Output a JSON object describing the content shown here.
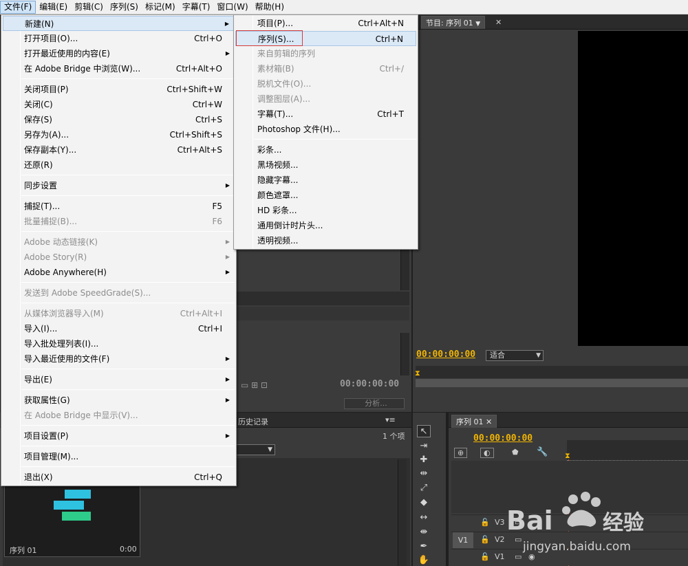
{
  "menubar": [
    "文件(F)",
    "编辑(E)",
    "剪辑(C)",
    "序列(S)",
    "标记(M)",
    "字幕(T)",
    "窗口(W)",
    "帮助(H)"
  ],
  "file_menu": [
    {
      "label": "新建(N)",
      "shortcut": "",
      "sub": true,
      "disabled": false,
      "highlight": true
    },
    {
      "label": "打开项目(O)...",
      "shortcut": "Ctrl+O",
      "sub": false,
      "disabled": false
    },
    {
      "label": "打开最近使用的内容(E)",
      "shortcut": "",
      "sub": true,
      "disabled": false
    },
    {
      "label": "在 Adobe Bridge 中浏览(W)...",
      "shortcut": "Ctrl+Alt+O",
      "sub": false,
      "disabled": false
    },
    {
      "sep": true
    },
    {
      "label": "关闭项目(P)",
      "shortcut": "Ctrl+Shift+W",
      "sub": false,
      "disabled": false
    },
    {
      "label": "关闭(C)",
      "shortcut": "Ctrl+W",
      "sub": false,
      "disabled": false
    },
    {
      "label": "保存(S)",
      "shortcut": "Ctrl+S",
      "sub": false,
      "disabled": false
    },
    {
      "label": "另存为(A)...",
      "shortcut": "Ctrl+Shift+S",
      "sub": false,
      "disabled": false
    },
    {
      "label": "保存副本(Y)...",
      "shortcut": "Ctrl+Alt+S",
      "sub": false,
      "disabled": false
    },
    {
      "label": "还原(R)",
      "shortcut": "",
      "sub": false,
      "disabled": false
    },
    {
      "sep": true
    },
    {
      "label": "同步设置",
      "shortcut": "",
      "sub": true,
      "disabled": false
    },
    {
      "sep": true
    },
    {
      "label": "捕捉(T)...",
      "shortcut": "F5",
      "sub": false,
      "disabled": false
    },
    {
      "label": "批量捕捉(B)...",
      "shortcut": "F6",
      "sub": false,
      "disabled": true
    },
    {
      "sep": true
    },
    {
      "label": "Adobe 动态链接(K)",
      "shortcut": "",
      "sub": true,
      "disabled": true
    },
    {
      "label": "Adobe Story(R)",
      "shortcut": "",
      "sub": true,
      "disabled": true
    },
    {
      "label": "Adobe Anywhere(H)",
      "shortcut": "",
      "sub": true,
      "disabled": false
    },
    {
      "sep": true
    },
    {
      "label": "发送到 Adobe SpeedGrade(S)...",
      "shortcut": "",
      "sub": false,
      "disabled": true
    },
    {
      "sep": true
    },
    {
      "label": "从媒体浏览器导入(M)",
      "shortcut": "Ctrl+Alt+I",
      "sub": false,
      "disabled": true
    },
    {
      "label": "导入(I)...",
      "shortcut": "Ctrl+I",
      "sub": false,
      "disabled": false
    },
    {
      "label": "导入批处理列表(I)...",
      "shortcut": "",
      "sub": false,
      "disabled": false
    },
    {
      "label": "导入最近使用的文件(F)",
      "shortcut": "",
      "sub": true,
      "disabled": false
    },
    {
      "sep": true
    },
    {
      "label": "导出(E)",
      "shortcut": "",
      "sub": true,
      "disabled": false
    },
    {
      "sep": true
    },
    {
      "label": "获取属性(G)",
      "shortcut": "",
      "sub": true,
      "disabled": false
    },
    {
      "label": "在 Adobe Bridge 中显示(V)...",
      "shortcut": "",
      "sub": false,
      "disabled": true
    },
    {
      "sep": true
    },
    {
      "label": "项目设置(P)",
      "shortcut": "",
      "sub": true,
      "disabled": false
    },
    {
      "sep": true
    },
    {
      "label": "项目管理(M)...",
      "shortcut": "",
      "sub": false,
      "disabled": false
    },
    {
      "sep": true
    },
    {
      "label": "退出(X)",
      "shortcut": "Ctrl+Q",
      "sub": false,
      "disabled": false
    }
  ],
  "new_submenu": [
    {
      "label": "项目(P)...",
      "shortcut": "Ctrl+Alt+N",
      "disabled": false
    },
    {
      "label": "序列(S)...",
      "shortcut": "Ctrl+N",
      "disabled": false,
      "highlight": true
    },
    {
      "label": "来自剪辑的序列",
      "shortcut": "",
      "disabled": true
    },
    {
      "label": "素材箱(B)",
      "shortcut": "Ctrl+/",
      "disabled": true
    },
    {
      "label": "脱机文件(O)...",
      "shortcut": "",
      "disabled": true
    },
    {
      "label": "调整图层(A)...",
      "shortcut": "",
      "disabled": true
    },
    {
      "label": "字幕(T)...",
      "shortcut": "Ctrl+T",
      "disabled": false
    },
    {
      "label": "Photoshop 文件(H)...",
      "shortcut": "",
      "disabled": false
    },
    {
      "sep": true
    },
    {
      "label": "彩条...",
      "shortcut": "",
      "disabled": false
    },
    {
      "label": "黑场视频...",
      "shortcut": "",
      "disabled": false
    },
    {
      "label": "隐藏字幕...",
      "shortcut": "",
      "disabled": false
    },
    {
      "label": "颜色遮罩...",
      "shortcut": "",
      "disabled": false
    },
    {
      "label": "HD 彩条...",
      "shortcut": "",
      "disabled": false
    },
    {
      "label": "通用倒计时片头...",
      "shortcut": "",
      "disabled": false
    },
    {
      "label": "透明视频...",
      "shortcut": "",
      "disabled": false
    }
  ],
  "program_monitor": {
    "tab": "节目: 序列 01",
    "timecode": "00:00:00:00",
    "fit": "适合"
  },
  "source_panel": {
    "timecode": "00:00:00:00",
    "analyze": "分析..."
  },
  "project_panel": {
    "tab": "历史记录",
    "count": "1 个项",
    "thumb_label": "序列 01",
    "thumb_dur": "0:00"
  },
  "timeline": {
    "tab": "序列 01",
    "timecode": "00:00:00:00",
    "tracks": [
      "V3",
      "V2",
      "V1"
    ],
    "source_patch": "V1"
  },
  "watermark": {
    "brand": "Bai",
    "cn": "经验",
    "url": "jingyan.baidu.com"
  },
  "colors": {
    "timecode": "#f0b400",
    "menu_bg": "#f3f3f3",
    "highlight": "#dbe8f6",
    "red_box": "#d63a3a"
  }
}
